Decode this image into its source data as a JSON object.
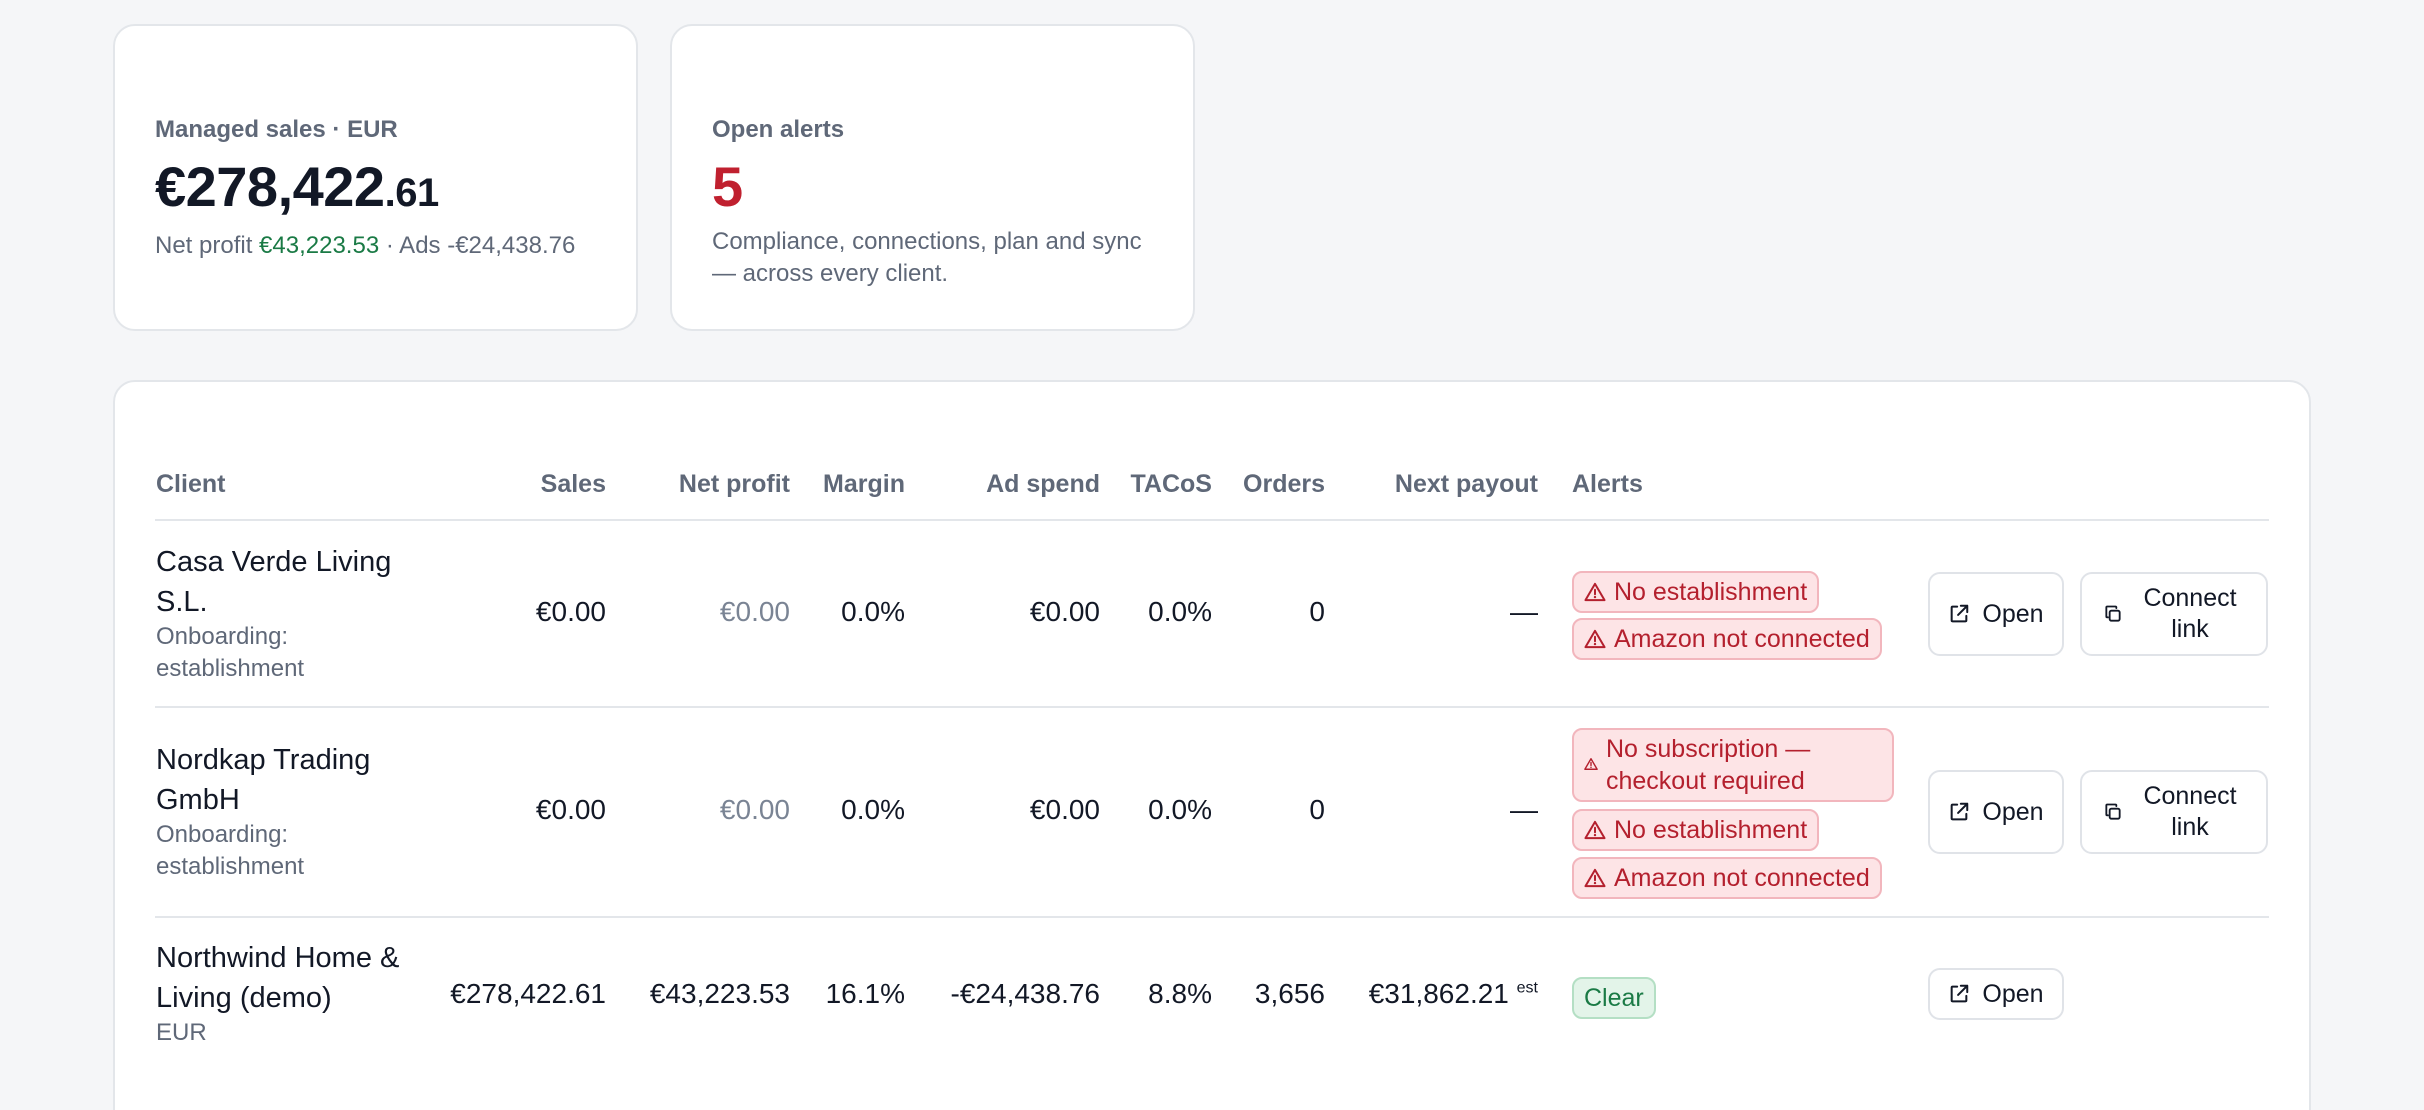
{
  "kpis": {
    "sales": {
      "label": "Managed sales · EUR",
      "value_main": "€278,422",
      "value_cents": ".61",
      "net_profit_label": "Net profit",
      "net_profit_value": "€43,223.53",
      "ads_text": "· Ads -€24,438.76"
    },
    "alerts": {
      "label": "Open alerts",
      "value": "5",
      "description": "Compliance, connections, plan and sync — across every client."
    }
  },
  "table": {
    "headers": {
      "client": "Client",
      "sales": "Sales",
      "net_profit": "Net profit",
      "margin": "Margin",
      "ad_spend": "Ad spend",
      "tacos": "TACoS",
      "orders": "Orders",
      "next_payout": "Next payout",
      "alerts": "Alerts"
    },
    "rows": [
      {
        "name": "Casa Verde Living S.L.",
        "sub": "Onboarding: establishment",
        "sales": "€0.00",
        "net_profit": "€0.00",
        "margin": "0.0%",
        "ad_spend": "€0.00",
        "tacos": "0.0%",
        "orders": "0",
        "next_payout": "—",
        "alerts": [
          "No establishment",
          "Amazon not connected"
        ],
        "open_label": "Open",
        "connect_label": "Connect link"
      },
      {
        "name": "Nordkap Trading GmbH",
        "sub": "Onboarding: establishment",
        "sales": "€0.00",
        "net_profit": "€0.00",
        "margin": "0.0%",
        "ad_spend": "€0.00",
        "tacos": "0.0%",
        "orders": "0",
        "next_payout": "—",
        "alerts": [
          "No subscription — checkout required",
          "No establishment",
          "Amazon not connected"
        ],
        "open_label": "Open",
        "connect_label": "Connect link"
      },
      {
        "name": "Northwind Home & Living (demo)",
        "sub": "EUR",
        "sales": "€278,422.61",
        "net_profit": "€43,223.53",
        "margin": "16.1%",
        "ad_spend": "-€24,438.76",
        "tacos": "8.8%",
        "orders": "3,656",
        "next_payout": "€31,862.21",
        "next_payout_note": "est",
        "alerts": [
          "Clear"
        ],
        "open_label": "Open"
      }
    ]
  },
  "icons": {
    "alert": "warning-triangle-icon",
    "open": "external-link-icon",
    "connect": "copy-link-icon"
  },
  "colors": {
    "danger": "#c0202f",
    "success": "#1a7a45",
    "muted": "#5f6878"
  }
}
